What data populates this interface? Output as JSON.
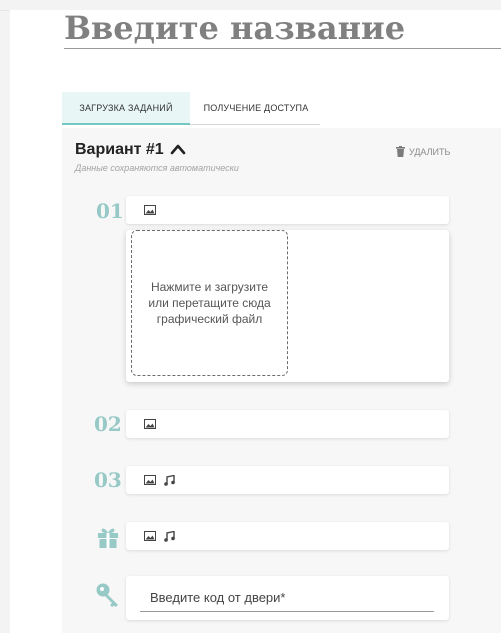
{
  "title": "Введите название",
  "tabs": [
    {
      "label": "ЗАГРУЗКА ЗАДАНИЙ",
      "active": true
    },
    {
      "label": "ПОЛУЧЕНИЕ ДОСТУПА",
      "active": false
    }
  ],
  "variant": {
    "title": "Вариант #1",
    "autosave_note": "Данные сохраняются автоматически",
    "delete_label": "УДАЛИТЬ"
  },
  "items": [
    {
      "number": "01",
      "icons": [
        "image-icon"
      ]
    },
    {
      "number": "02",
      "icons": [
        "image-icon"
      ]
    },
    {
      "number": "03",
      "icons": [
        "image-icon",
        "music-note-icon"
      ]
    }
  ],
  "dropzone": {
    "text": "Нажмите и загрузите или перетащите сюда графический файл"
  },
  "gift_row": {
    "icon": "gift-icon",
    "icons": [
      "image-icon",
      "music-note-icon"
    ]
  },
  "code_row": {
    "icon": "key-icon",
    "placeholder": "Введите код от двери*"
  },
  "colors": {
    "accent": "#74c7c2",
    "number": "#97c9c7",
    "tab_active_bg": "#e8f6f5"
  }
}
